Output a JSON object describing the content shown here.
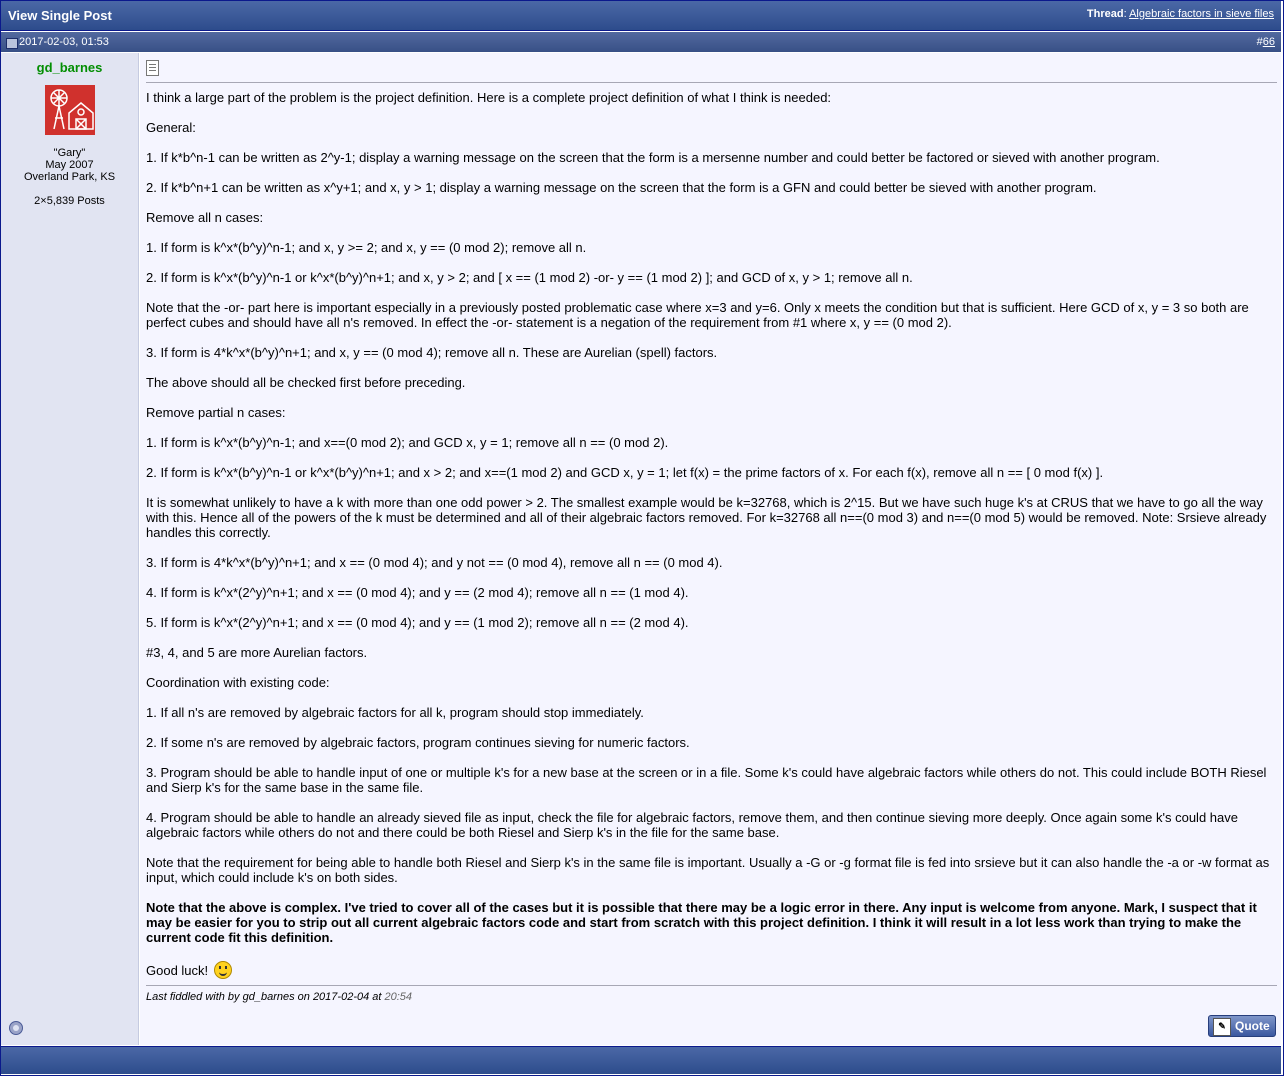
{
  "window": {
    "title": "View Single Post",
    "thread_label": "Thread",
    "thread_link": "Algebraic factors in sieve files"
  },
  "post": {
    "date": "2017-02-03, 01:53",
    "number_prefix": "#",
    "number": "66",
    "user": {
      "name": "gd_barnes",
      "nickname": "\"Gary\"",
      "join_date": "May 2007",
      "location": "Overland Park, KS",
      "posts": "2×5,839 Posts"
    },
    "paragraphs": [
      "I think a large part of the problem is the project definition. Here is a complete project definition of what I think is needed:",
      "General:",
      "1. If k*b^n-1 can be written as 2^y-1; display a warning message on the screen that the form is a mersenne number and could better be factored or sieved with another program.",
      "2. If k*b^n+1 can be written as x^y+1; and x, y > 1; display a warning message on the screen that the form is a GFN and could better be sieved with another program.",
      "Remove all n cases:",
      "1. If form is k^x*(b^y)^n-1; and x, y >= 2; and x, y == (0 mod 2); remove all n.",
      "2. If form is k^x*(b^y)^n-1 or k^x*(b^y)^n+1; and x, y > 2; and [ x == (1 mod 2) -or- y == (1 mod 2) ]; and GCD of x, y > 1; remove all n.",
      "Note that the -or- part here is important especially in a previously posted problematic case where x=3 and y=6. Only x meets the condition but that is sufficient. Here GCD of x, y = 3 so both are perfect cubes and should have all n's removed. In effect the -or- statement is a negation of the requirement from #1 where x, y == (0 mod 2).",
      "3. If form is 4*k^x*(b^y)^n+1; and x, y == (0 mod 4); remove all n. These are Aurelian (spell) factors.",
      "The above should all be checked first before preceding.",
      "Remove partial n cases:",
      "1. If form is k^x*(b^y)^n-1; and x==(0 mod 2); and GCD x, y = 1; remove all n == (0 mod 2).",
      "2. If form is k^x*(b^y)^n-1 or k^x*(b^y)^n+1; and x > 2; and x==(1 mod 2) and GCD x, y = 1; let f(x) = the prime factors of x. For each f(x), remove all n == [ 0 mod f(x) ].",
      "It is somewhat unlikely to have a k with more than one odd power > 2. The smallest example would be k=32768, which is 2^15. But we have such huge k's at CRUS that we have to go all the way with this. Hence all of the powers of the k must be determined and all of their algebraic factors removed. For k=32768 all n==(0 mod 3) and n==(0 mod 5) would be removed. Note: Srsieve already handles this correctly.",
      "3. If form is 4*k^x*(b^y)^n+1; and x == (0 mod 4); and y not == (0 mod 4), remove all n == (0 mod 4).",
      "4. If form is k^x*(2^y)^n+1; and x == (0 mod 4); and y == (2 mod 4); remove all n == (1 mod 4).",
      "5. If form is k^x*(2^y)^n+1; and x == (0 mod 4); and y == (1 mod 2); remove all n == (2 mod 4).",
      "#3, 4, and 5 are more Aurelian factors.",
      "Coordination with existing code:",
      "1. If all n's are removed by algebraic factors for all k, program should stop immediately.",
      "2. If some n's are removed by algebraic factors, program continues sieving for numeric factors.",
      "3. Program should be able to handle input of one or multiple k's for a new base at the screen or in a file. Some k's could have algebraic factors while others do not. This could include BOTH Riesel and Sierp k's for the same base in the same file.",
      "4. Program should be able to handle an already sieved file as input, check the file for algebraic factors, remove them, and then continue sieving more deeply. Once again some k's could have algebraic factors while others do not and there could be both Riesel and Sierp k's in the file for the same base.",
      "Note that the requirement for being able to handle both Riesel and Sierp k's in the same file is important. Usually a -G or -g format file is fed into srsieve but it can also handle the -a or -w format as input, which could include k's on both sides."
    ],
    "bold_paragraph": "Note that the above is complex. I've tried to cover all of the cases but it is possible that there may be a logic error in there. Any input is welcome from anyone. Mark, I suspect that it may be easier for you to strip out all current algebraic factors code and start from scratch with this project definition. I think it will result in a lot less work than trying to make the current code fit this definition.",
    "closing": "Good luck!",
    "last_edit_text": "Last fiddled with by gd_barnes on 2017-02-04 at",
    "last_edit_time": "20:54",
    "quote_button": "Quote"
  },
  "colors": {
    "bar": "#2d4c8c",
    "username": "#038e03",
    "post_bg": "#f5f5ff",
    "user_bg": "#e1e4f2"
  },
  "icons": [
    "old-post-icon",
    "post-doc-icon",
    "avatar-windmill-barn-icon",
    "offline-status-icon",
    "smiley-icon",
    "quote-icon"
  ]
}
